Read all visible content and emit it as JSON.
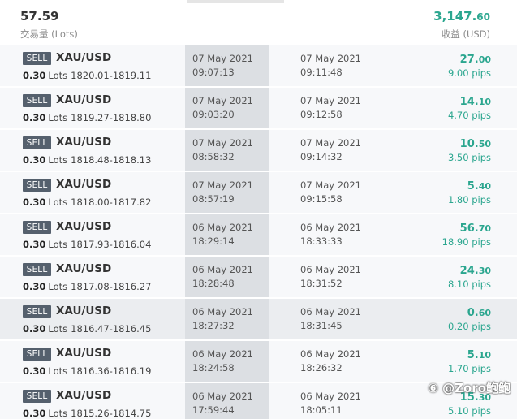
{
  "summary": {
    "total_lots": "57.59",
    "total_lots_label": "交易量 (Lots)",
    "total_profit_int": "3,147.",
    "total_profit_dec": "60",
    "total_profit_label": "收益 (USD)"
  },
  "trades": [
    {
      "side": "SELL",
      "symbol": "XAU/USD",
      "volume": "0.30",
      "lots_label": "Lots",
      "prices": "1820.01-1819.11",
      "open_date": "07 May 2021",
      "open_time": "09:07:13",
      "close_date": "07 May 2021",
      "close_time": "09:11:48",
      "profit_int": "27.",
      "profit_dec": "00",
      "pips": "9.00 pips"
    },
    {
      "side": "SELL",
      "symbol": "XAU/USD",
      "volume": "0.30",
      "lots_label": "Lots",
      "prices": "1819.27-1818.80",
      "open_date": "07 May 2021",
      "open_time": "09:03:20",
      "close_date": "07 May 2021",
      "close_time": "09:12:58",
      "profit_int": "14.",
      "profit_dec": "10",
      "pips": "4.70 pips"
    },
    {
      "side": "SELL",
      "symbol": "XAU/USD",
      "volume": "0.30",
      "lots_label": "Lots",
      "prices": "1818.48-1818.13",
      "open_date": "07 May 2021",
      "open_time": "08:58:32",
      "close_date": "07 May 2021",
      "close_time": "09:14:32",
      "profit_int": "10.",
      "profit_dec": "50",
      "pips": "3.50 pips"
    },
    {
      "side": "SELL",
      "symbol": "XAU/USD",
      "volume": "0.30",
      "lots_label": "Lots",
      "prices": "1818.00-1817.82",
      "open_date": "07 May 2021",
      "open_time": "08:57:19",
      "close_date": "07 May 2021",
      "close_time": "09:15:58",
      "profit_int": "5.",
      "profit_dec": "40",
      "pips": "1.80 pips"
    },
    {
      "side": "SELL",
      "symbol": "XAU/USD",
      "volume": "0.30",
      "lots_label": "Lots",
      "prices": "1817.93-1816.04",
      "open_date": "06 May 2021",
      "open_time": "18:29:14",
      "close_date": "06 May 2021",
      "close_time": "18:33:33",
      "profit_int": "56.",
      "profit_dec": "70",
      "pips": "18.90 pips"
    },
    {
      "side": "SELL",
      "symbol": "XAU/USD",
      "volume": "0.30",
      "lots_label": "Lots",
      "prices": "1817.08-1816.27",
      "open_date": "06 May 2021",
      "open_time": "18:28:48",
      "close_date": "06 May 2021",
      "close_time": "18:31:52",
      "profit_int": "24.",
      "profit_dec": "30",
      "pips": "8.10 pips"
    },
    {
      "side": "SELL",
      "symbol": "XAU/USD",
      "volume": "0.30",
      "lots_label": "Lots",
      "prices": "1816.47-1816.45",
      "open_date": "06 May 2021",
      "open_time": "18:27:32",
      "close_date": "06 May 2021",
      "close_time": "18:31:45",
      "profit_int": "0.",
      "profit_dec": "60",
      "pips": "0.20 pips"
    },
    {
      "side": "SELL",
      "symbol": "XAU/USD",
      "volume": "0.30",
      "lots_label": "Lots",
      "prices": "1816.36-1816.19",
      "open_date": "06 May 2021",
      "open_time": "18:24:58",
      "close_date": "06 May 2021",
      "close_time": "18:26:32",
      "profit_int": "5.",
      "profit_dec": "10",
      "pips": "1.70 pips"
    },
    {
      "side": "SELL",
      "symbol": "XAU/USD",
      "volume": "0.30",
      "lots_label": "Lots",
      "prices": "1815.26-1814.75",
      "open_date": "06 May 2021",
      "open_time": "17:59:44",
      "close_date": "06 May 2021",
      "close_time": "18:05:11",
      "profit_int": "15.",
      "profit_dec": "30",
      "pips": "5.10 pips"
    }
  ],
  "highlight_row": 6,
  "colors": {
    "profit": "#2ba68f",
    "badge": "#55606d"
  },
  "watermark": "⑥ @Zoro鲍鲍"
}
